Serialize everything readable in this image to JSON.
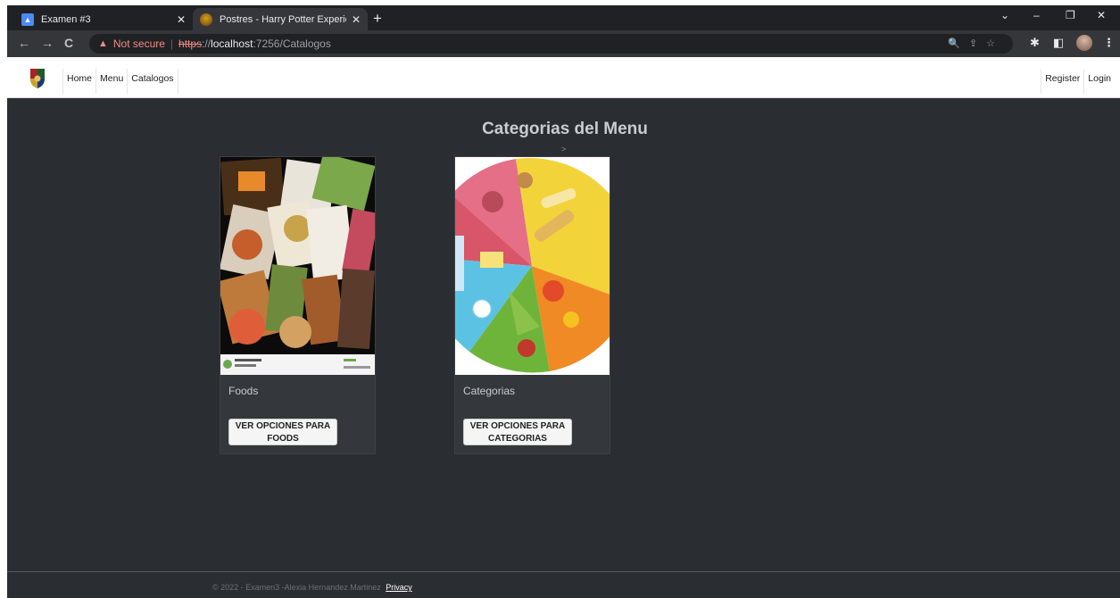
{
  "browser": {
    "tabs": [
      {
        "title": "Examen #3",
        "close": "✕"
      },
      {
        "title": "Postres - Harry Potter Experience",
        "close": "✕"
      }
    ],
    "new_tab": "+",
    "controls": {
      "chevron": "⌄",
      "minimize": "–",
      "restore": "❐",
      "close": "✕"
    },
    "nav": {
      "back": "←",
      "forward": "→",
      "reload": "C"
    },
    "address": {
      "warning": "▲",
      "security": "Not secure",
      "separator": "|",
      "scheme": "https",
      "scheme_sep": "://",
      "host": "localhost",
      "path": ":7256/Catalogos"
    },
    "omni_icons": "🔍⇪☆",
    "toolbar_right": {
      "extensions": "✱",
      "sidebar": "◧",
      "menu": "⋮"
    }
  },
  "site": {
    "nav": {
      "links": [
        "Home",
        "Menu",
        "Catalogos"
      ],
      "right": [
        "Register",
        "Login"
      ]
    },
    "heading": "Categorias del Menu",
    "breadcrumb": ">",
    "cards": [
      {
        "title": "Foods",
        "button": "VER OPCIONES PARA FOODS"
      },
      {
        "title": "Categorias",
        "button": "VER OPCIONES PARA CATEGORIAS"
      }
    ],
    "footer": {
      "text": "© 2022 - Examen3 -Alexia Hernandez Martinez",
      "link": "Privacy"
    }
  },
  "colors": {
    "page_bg": "#2a2d31",
    "card_bg": "#34373c",
    "chrome_bg": "#202124",
    "toolbar_bg": "#35363a"
  }
}
